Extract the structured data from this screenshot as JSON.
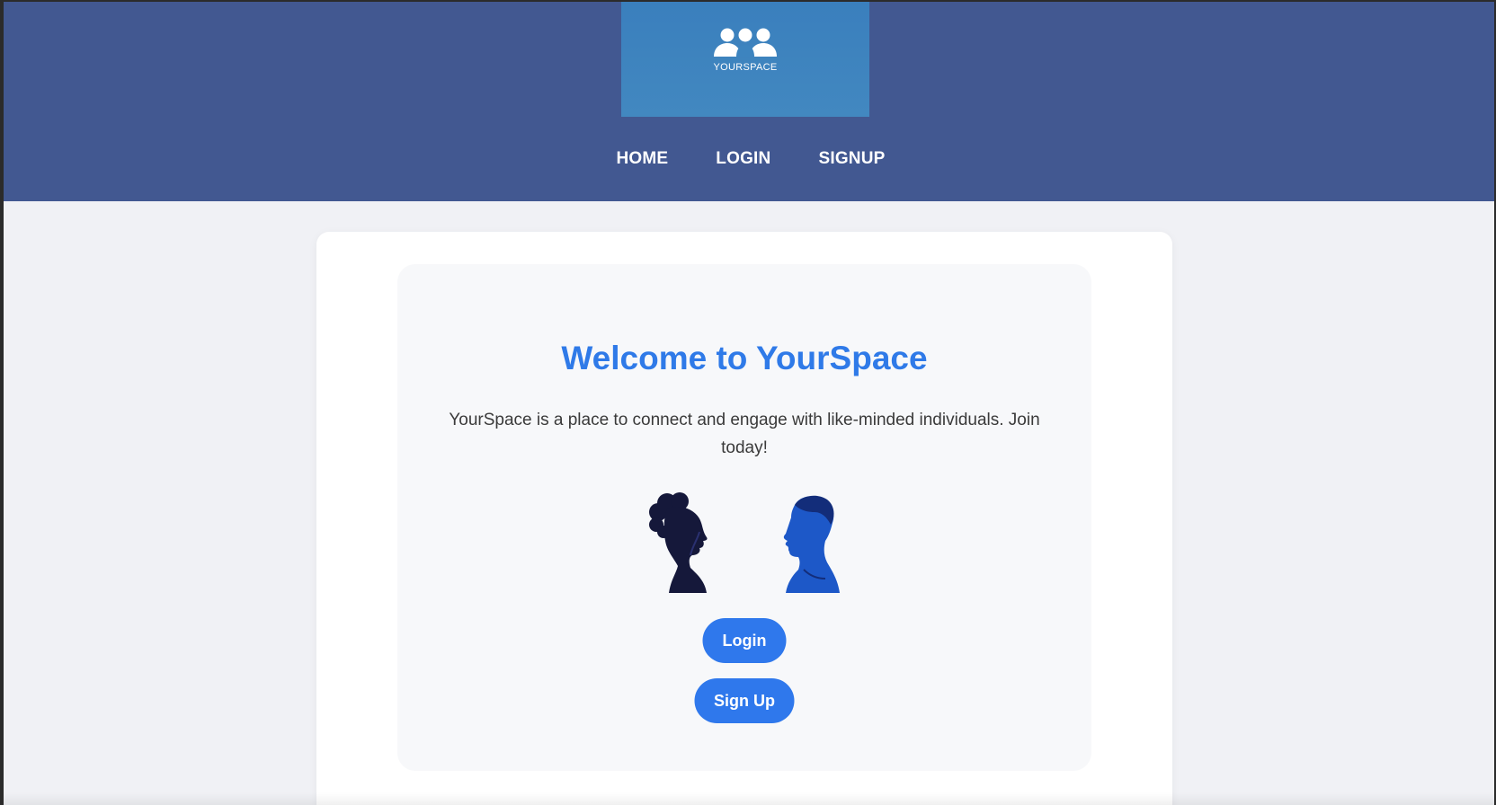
{
  "header": {
    "logo_text": "YOURSPACE",
    "logo_icon": "people-group-icon",
    "nav": [
      {
        "label": "HOME"
      },
      {
        "label": "LOGIN"
      },
      {
        "label": "SIGNUP"
      }
    ]
  },
  "hero": {
    "title": "Welcome to YourSpace",
    "description": "YourSpace is a place to connect and engage with like-minded individuals. Join today!",
    "illustration": "two-profile-silhouettes",
    "login_label": "Login",
    "signup_label": "Sign Up"
  },
  "colors": {
    "header_bg": "#425891",
    "logo_bg": "#3d84bf",
    "accent": "#2f78ec",
    "page_bg": "#f0f1f5"
  }
}
